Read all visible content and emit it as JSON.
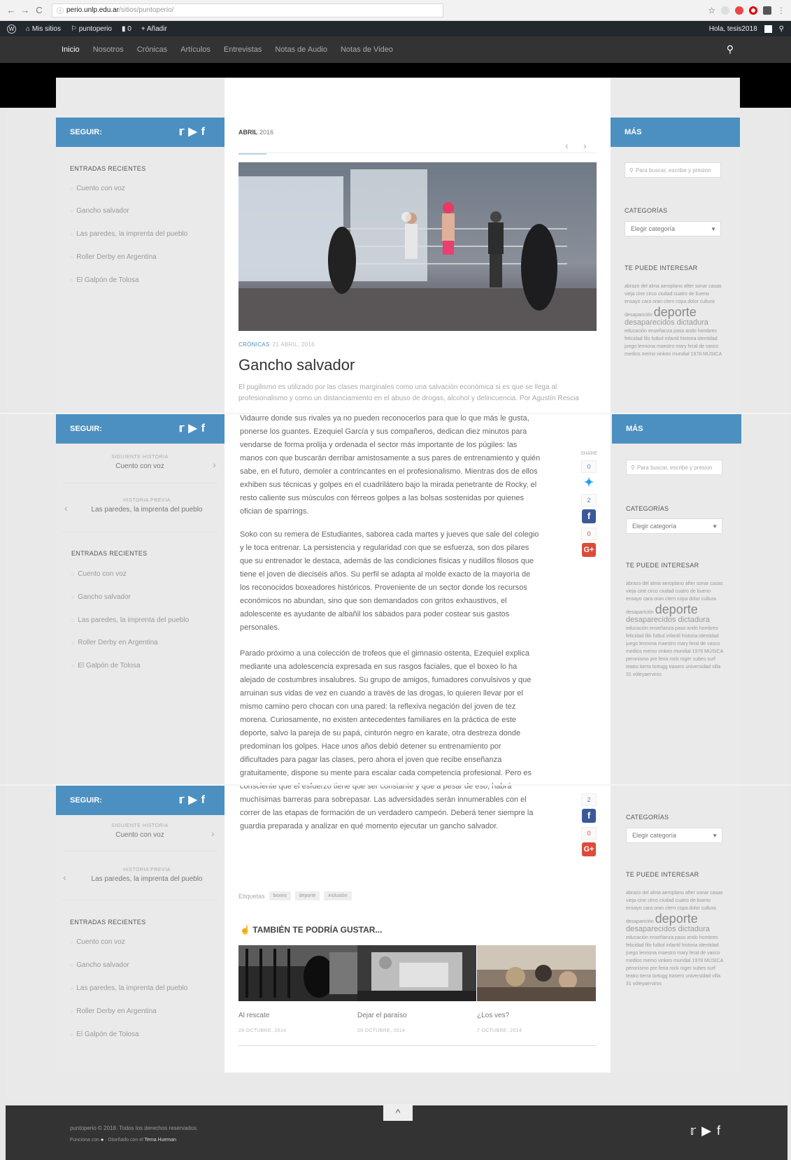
{
  "browser": {
    "url_host": "perio.unlp.edu.ar",
    "url_path": "/sitios/puntoperio/",
    "back": "←",
    "forward": "→",
    "reload": "C",
    "info": "ⓘ"
  },
  "admin_bar": {
    "wp_logo": "W",
    "my_sites": "Mis sitios",
    "site_name": "puntoperio",
    "comments_count": "0",
    "add_new": "+ Añadir",
    "greeting": "Hola, tesis2018"
  },
  "nav": {
    "items": [
      "Inicio",
      "Nosotros",
      "Crónicas",
      "Artículos",
      "Entrevistas",
      "Notas de Audio",
      "Notas de Video"
    ]
  },
  "left": {
    "follow_label": "SEGUIR:",
    "social_icons": [
      "twitter-icon",
      "youtube-icon",
      "facebook-icon"
    ],
    "recent_title": "ENTRADAS RECIENTES",
    "recent": [
      "Cuento con voz",
      "Gancho salvador",
      "Las paredes, la imprenta del pueblo",
      "Roller Derby en Argentina",
      "El Galpón de Tolosa"
    ],
    "next_label": "SIGUIENTE HISTORIA",
    "next_title": "Cuento con voz",
    "prev_label": "HISTORIA PREVIA",
    "prev_title": "Las paredes, la imprenta del pueblo"
  },
  "center": {
    "date_month": "ABRIL",
    "date_year": "2016",
    "category": "CRÓNICAS",
    "date_full": "21 ABRIL, 2016",
    "title": "Gancho salvador",
    "excerpt": "El pugilismo es utilizado por las clases marginales como una salvación económica si es que se llega al profesionalismo y como un distanciamiento en el abuso de drogas, alcohol y delincuencia. Por Agustín Rescia",
    "p1": "Vidaurre donde sus rivales ya no pueden reconocerlos para que lo que más le gusta, ponerse los guantes. Ezequiel García y sus compañeros, dedican diez minutos para vendarse de forma prolija y ordenada el sector más importante de los púgiles: las manos con que buscarán derribar amistosamente a sus pares de entrenamiento y quién sabe, en el futuro, demoler a contrincantes en el profesionalismo. Mientras dos de ellos exhiben sus técnicas y golpes en el cuadrilátero bajo la mirada penetrante de Rocky, el resto caliente sus músculos con férreos golpes a las bolsas sostenidas por quienes ofician de sparrings.",
    "p2": "Soko con su remera de Estudiantes, saborea cada martes y jueves que sale del colegio y le toca entrenar. La persistencia y regularidad con que se esfuerza, son dos pilares que su entrenador le destaca, además de las condiciones físicas y nudillos filosos que tiene el joven de dieciséis años. Su perfil se adapta al molde exacto de la mayoría de los reconocidos boxeadores históricos. Proveniente de un sector donde los recursos económicos no abundan, sino que son demandados con gritos exhaustivos, el adolescente es ayudante de albañil los sábados para poder costear sus gastos personales.",
    "p3": "Parado próximo a una colección de trofeos que el gimnasio ostenta, Ezequiel explica mediante una adolescencia expresada en sus rasgos faciales, que el boxeo lo ha alejado de costumbres insalubres. Su grupo de amigos, fumadores convulsivos y que arruinan sus vidas de vez en cuando a través de las drogas, lo quieren llevar por el mismo camino pero chocan con una pared: la reflexiva negación del joven de tez morena. Curiosamente, no existen antecedentes familiares en la práctica de este deporte, salvo la pareja de su papá, cinturón negro en karate, otra destreza donde predominan los golpes. Hace unos años debió detener su entrenamiento por dificultades para pagar las clases, pero ahora el joven que recibe enseñanza gratuitamente, dispone su mente para escalar cada competencia profesional. Pero es consciente que el esfuerzo tiene que ser constante y que a pesar de eso, habrá muchísimas barreras para sobrepasar. Las adversidades serán innumerables con el correr de las etapas de formación de un verdadero campeón. Deberá tener siempre la guardia preparada y analizar en qué momento ejecutar un gancho salvador.",
    "share_label": "SHARE",
    "share_counts_a": [
      "0",
      "2",
      "0"
    ],
    "share_counts_b": [
      "2",
      "0"
    ],
    "tags_label": "Etiquetas",
    "tags": [
      "boxeo",
      "deporte",
      "inclusión"
    ],
    "related_title": "TAMBIÉN TE PODRÍA GUSTAR...",
    "related": [
      {
        "title": "Al rescate",
        "date": "28 OCTUBRE, 2014"
      },
      {
        "title": "Dejar el paraíso",
        "date": "28 OCTUBRE, 2014"
      },
      {
        "title": "¿Los ves?",
        "date": "7 OCTUBRE, 2014"
      }
    ]
  },
  "right": {
    "more_label": "MÁS",
    "search_placeholder": "Para buscar, escribe y presion",
    "categories_title": "CATEGORÍAS",
    "categories_select": "Elegir categoría",
    "tags_title": "TE PUEDE INTERESAR",
    "tags_small_1": "abrazo del alma aeroplano after sonar casas vieja cine circo ciudad cuatro de bueno ensayo cara oran clern copa dolor",
    "tags_lead": "cultura desaparición",
    "tags_big": "deporte",
    "tags_mid": "desaparecidos dictadura",
    "tags_small_2": "educación enseñanza paso ando hombres felicidad filo futbol infantil historia identidad juego lennona maestro mary feral de vasco medios memo vinkeo mundial 1978 MÚSICA",
    "tags_small_3": "peronismo pre feria rock roger subes surf teatro tierra tortugg trasero universidad villa 31 vóleyaerviros"
  },
  "footer": {
    "copyright": "puntoperio © 2018. Todos los derechos reservados.",
    "powered": "Funciona con",
    "designed": "· Diseñado con el",
    "theme": "Tema Hueman",
    "to_top": "^",
    "social_icons": [
      "twitter-icon",
      "youtube-icon",
      "facebook-icon"
    ]
  },
  "colors": {
    "accent": "#4b90c0",
    "admin_bar": "#23282d",
    "nav_bg": "#333333",
    "footer_bg": "#333333"
  }
}
